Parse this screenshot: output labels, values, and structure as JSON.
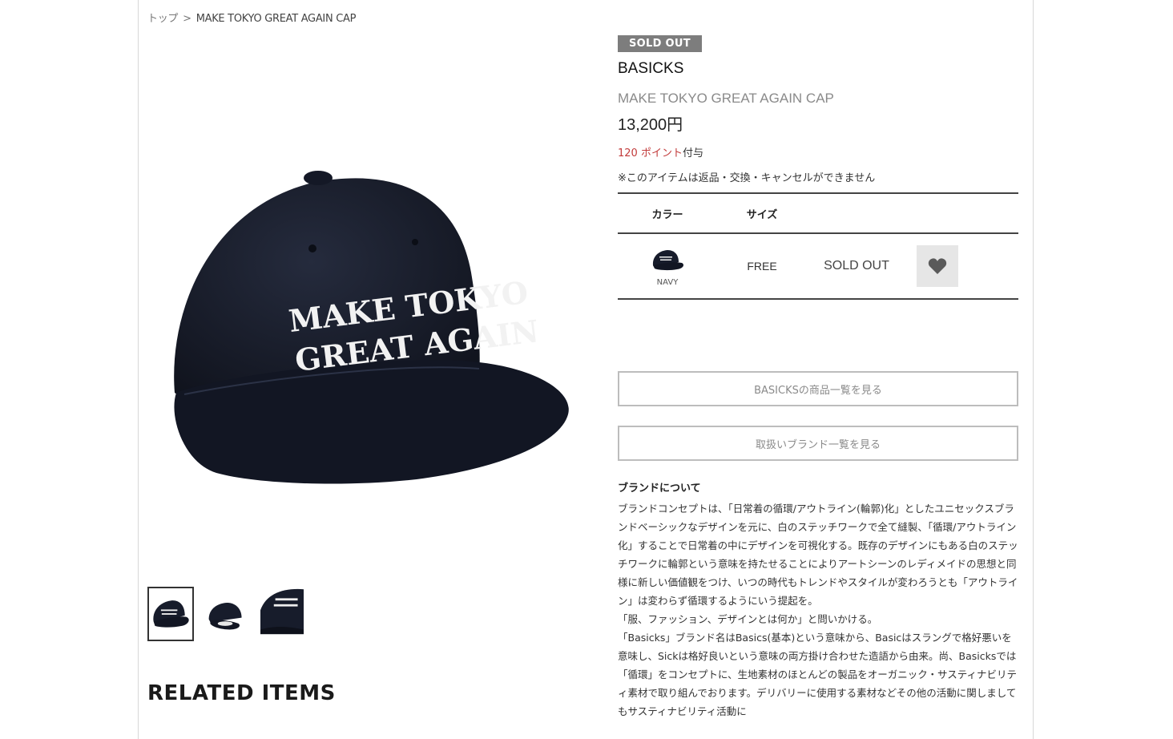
{
  "breadcrumb": {
    "home": "トップ",
    "separator": ">",
    "current": "MAKE TOKYO GREAT AGAIN CAP"
  },
  "product": {
    "status_badge": "SOLD OUT",
    "brand": "BASICKS",
    "name": "MAKE TOKYO GREAT AGAIN CAP",
    "price": "13,200円",
    "points_value": "120 ポイント",
    "points_suffix": "付与",
    "notice": "※このアイテムは返品・交換・キャンセルができません",
    "cap_text_line1": "MAKE TOKYO",
    "cap_text_line2": "GREAT AGAIN"
  },
  "variant_table": {
    "color_header": "カラー",
    "size_header": "サイズ",
    "rows": [
      {
        "color": "NAVY",
        "size": "FREE",
        "stock": "SOLD OUT"
      }
    ]
  },
  "buttons": {
    "brand_items": "BASICKSの商品一覧を見る",
    "brand_list": "取扱いブランド一覧を見る"
  },
  "about": {
    "title": "ブランドについて",
    "paragraphs": [
      "ブランドコンセプトは、「日常着の循環/アウトライン(輪郭)化」としたユニセックスブランドベーシックなデザインを元に、白のステッチワークで全て縫製、「循環/アウトライン化」することで日常着の中にデザインを可視化する。既存のデザインにもある白のステッチワークに輪郭という意味を持たせることによりアートシーンのレディメイドの思想と同様に新しい価値観をつけ、いつの時代もトレンドやスタイルが変わろうとも「アウトライン」は変わらず循環するようにいう提起を。",
      "「服、ファッション、デザインとは何か」と問いかける。",
      "「Basicks」ブランド名はBasics(基本)という意味から、Basicはスラングで格好悪いを意味し、Sickは格好良いという意味の両方掛け合わせた造語から由来。尚、Basicksでは「循環」をコンセプトに、生地素材のほとんどの製品をオーガニック・サスティナビリティ素材で取り組んでおります。デリバリーに使用する素材などその他の活動に関しましてもサスティナビリティ活動に"
    ]
  },
  "related_heading": "RELATED ITEMS",
  "colors": {
    "cap_navy": "#171c2b",
    "badge_gray": "#7d7d7d",
    "points_red": "#c23b3b"
  }
}
